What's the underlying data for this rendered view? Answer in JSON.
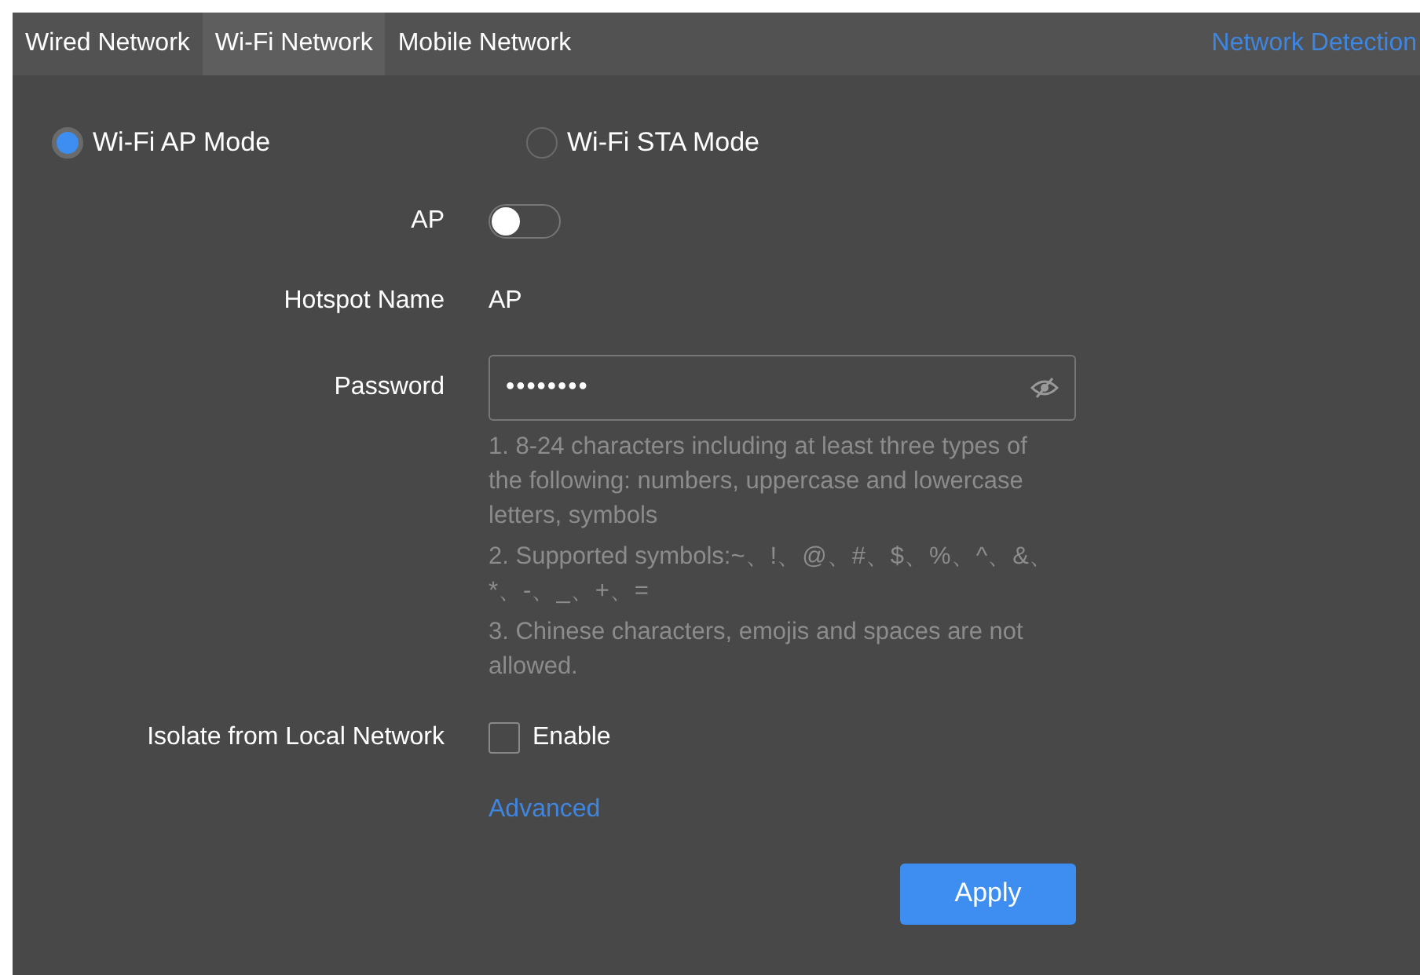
{
  "tabs": [
    {
      "label": "Wired Network",
      "selected": false
    },
    {
      "label": "Wi-Fi Network",
      "selected": true
    },
    {
      "label": "Mobile Network",
      "selected": false
    }
  ],
  "network_detection": "Network Detection",
  "modes": [
    {
      "label": "Wi-Fi AP Mode",
      "selected": true
    },
    {
      "label": "Wi-Fi STA Mode",
      "selected": false
    }
  ],
  "ap": {
    "label": "AP",
    "on": false
  },
  "hotspot_name": {
    "label": "Hotspot Name",
    "value": "AP"
  },
  "password": {
    "label": "Password",
    "value": "••••••••",
    "hints": [
      "1. 8-24 characters including at least three types of the following: numbers, uppercase and lowercase letters, symbols",
      "2. Supported symbols:~、!、@、#、$、%、^、&、*、-、_、+、=",
      "3. Chinese characters, emojis and spaces are not allowed."
    ]
  },
  "isolate": {
    "label": "Isolate from Local Network",
    "option": "Enable",
    "checked": false
  },
  "advanced": "Advanced",
  "apply": "Apply"
}
